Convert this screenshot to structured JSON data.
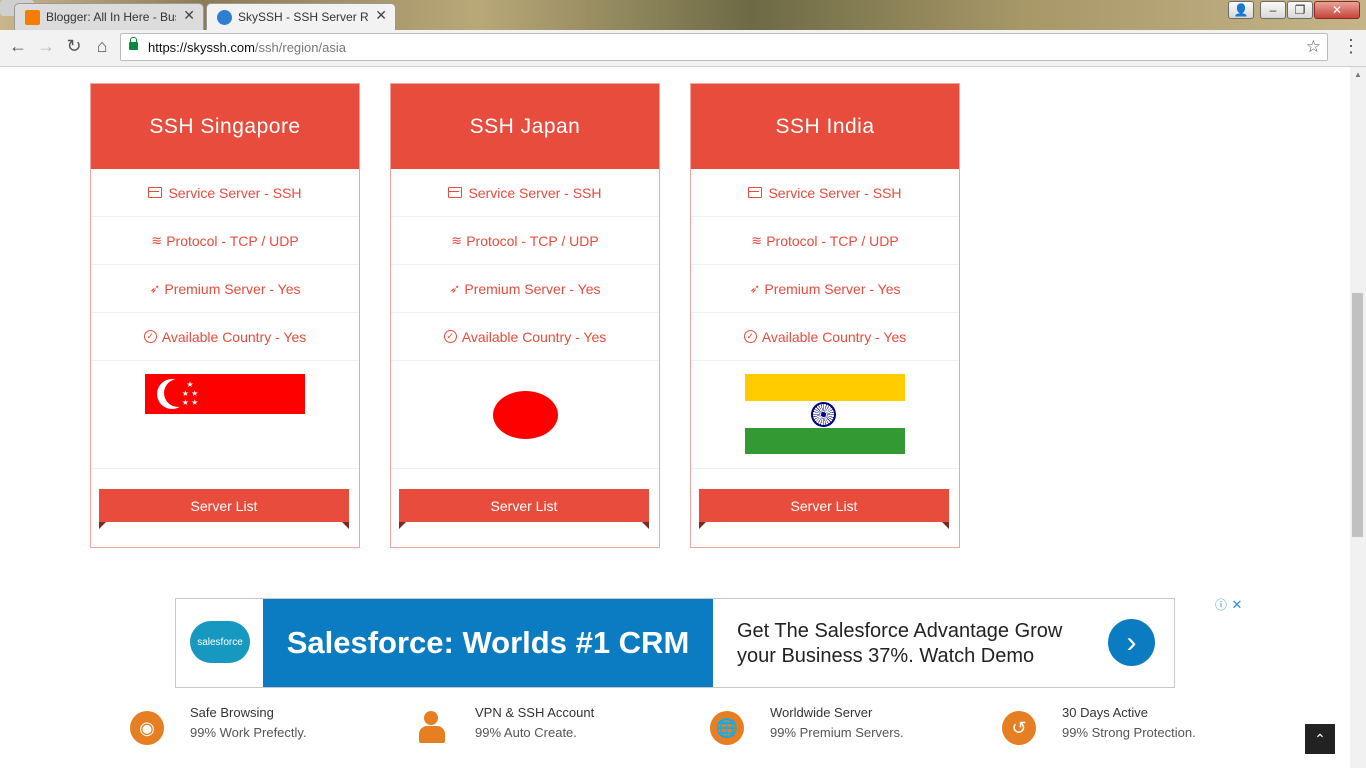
{
  "browser": {
    "tabs": [
      {
        "title": "Blogger: All In Here - Bus",
        "active": false
      },
      {
        "title": "SkySSH - SSH Server Reg",
        "active": true
      }
    ],
    "url_host": "https://skyssh.com",
    "url_path": "/ssh/region/asia"
  },
  "cards": [
    {
      "title": "SSH Singapore",
      "features": [
        "Service Server - SSH",
        "Protocol - TCP / UDP",
        "Premium Server - Yes",
        "Available Country - Yes"
      ],
      "button": "Server List",
      "flag": "singapore"
    },
    {
      "title": "SSH Japan",
      "features": [
        "Service Server - SSH",
        "Protocol - TCP / UDP",
        "Premium Server - Yes",
        "Available Country - Yes"
      ],
      "button": "Server List",
      "flag": "japan"
    },
    {
      "title": "SSH India",
      "features": [
        "Service Server - SSH",
        "Protocol - TCP / UDP",
        "Premium Server - Yes",
        "Available Country - Yes"
      ],
      "button": "Server List",
      "flag": "india"
    }
  ],
  "ad": {
    "logo_text": "salesforce",
    "headline": "Salesforce: Worlds #1 CRM",
    "body": "Get The Salesforce Advantage Grow your Business 37%. Watch Demo"
  },
  "features": [
    {
      "title": "Safe Browsing",
      "subtitle": "99% Work Prefectly.",
      "icon": "chrome-icon"
    },
    {
      "title": "VPN & SSH Account",
      "subtitle": "99% Auto Create.",
      "icon": "user-icon"
    },
    {
      "title": "Worldwide Server",
      "subtitle": "99% Premium Servers.",
      "icon": "globe-icon"
    },
    {
      "title": "30 Days Active",
      "subtitle": "99% Strong Protection.",
      "icon": "history-icon"
    }
  ],
  "colors": {
    "accent": "#e74c3c",
    "feature_icon": "#e67e22",
    "ad_blue": "#0b7cc1"
  }
}
